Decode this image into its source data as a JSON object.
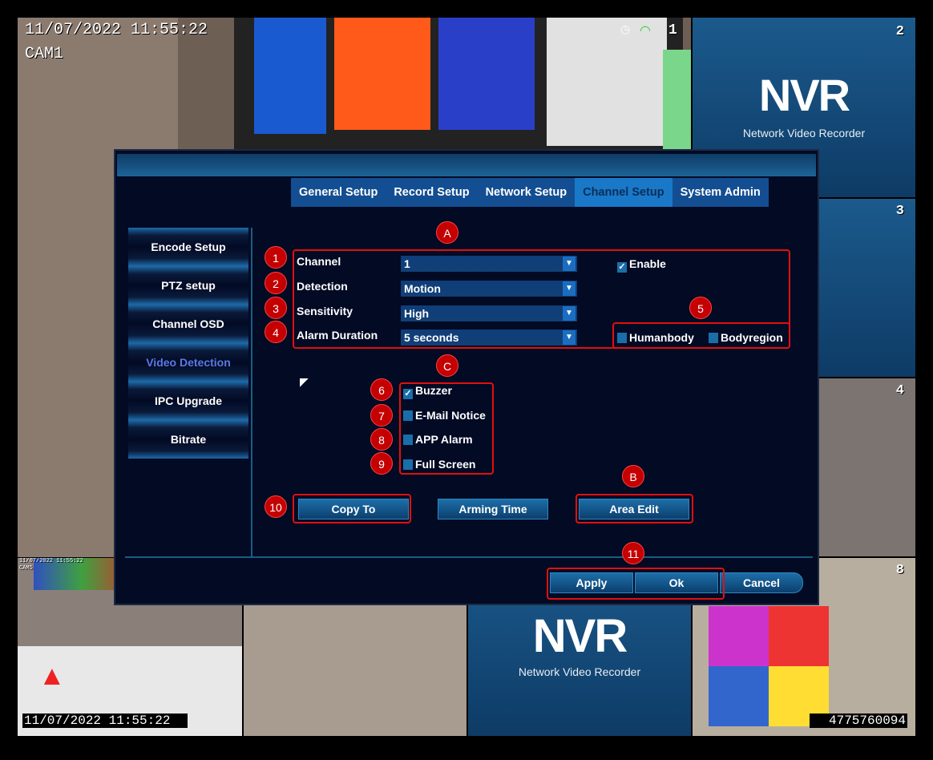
{
  "camera": {
    "main_datetime": "11/07/2022 11:55:22",
    "main_name": "CAM1",
    "channel_numbers": [
      "1",
      "2",
      "3",
      "4",
      "8"
    ],
    "nvr_logo": "NVR",
    "nvr_subtitle": "Network Video Recorder",
    "small_datetime": "11/07/2022 11:55:22",
    "small_name": "CAM5",
    "bottom_datetime": "11/07/2022 11:55:22",
    "device_id": "4775760094"
  },
  "tabs": [
    {
      "label": "General Setup"
    },
    {
      "label": "Record Setup"
    },
    {
      "label": "Network Setup"
    },
    {
      "label": "Channel Setup",
      "active": true
    },
    {
      "label": "System Admin"
    }
  ],
  "sidebar": [
    {
      "label": "Encode Setup"
    },
    {
      "label": "PTZ setup"
    },
    {
      "label": "Channel OSD"
    },
    {
      "label": "Video Detection",
      "active": true
    },
    {
      "label": "IPC Upgrade"
    },
    {
      "label": "Bitrate"
    }
  ],
  "form": {
    "channel": {
      "label": "Channel",
      "value": "1"
    },
    "detection": {
      "label": "Detection",
      "value": "Motion"
    },
    "sensitivity": {
      "label": "Sensitivity",
      "value": "High"
    },
    "alarm_duration": {
      "label": "Alarm Duration",
      "value": "5 seconds"
    },
    "enable": {
      "label": "Enable",
      "checked": true
    },
    "humanbody": {
      "label": "Humanbody",
      "checked": false
    },
    "bodyregion": {
      "label": "Bodyregion",
      "checked": false
    }
  },
  "actions": [
    {
      "label": "Buzzer",
      "checked": true
    },
    {
      "label": "E-Mail Notice",
      "checked": false
    },
    {
      "label": "APP Alarm",
      "checked": false
    },
    {
      "label": "Full Screen",
      "checked": false
    }
  ],
  "buttons": {
    "copy_to": "Copy To",
    "arming_time": "Arming Time",
    "area_edit": "Area Edit",
    "apply": "Apply",
    "ok": "Ok",
    "cancel": "Cancel"
  },
  "annotations": {
    "a": "A",
    "b": "B",
    "c": "C",
    "n1": "1",
    "n2": "2",
    "n3": "3",
    "n4": "4",
    "n5": "5",
    "n6": "6",
    "n7": "7",
    "n8": "8",
    "n9": "9",
    "n10": "10",
    "n11": "11"
  },
  "colors": {
    "annotation": "#c40000",
    "accent": "#1a78c9",
    "dialog_bg": "#020a24",
    "active_sidebar": "#5b79e8"
  }
}
